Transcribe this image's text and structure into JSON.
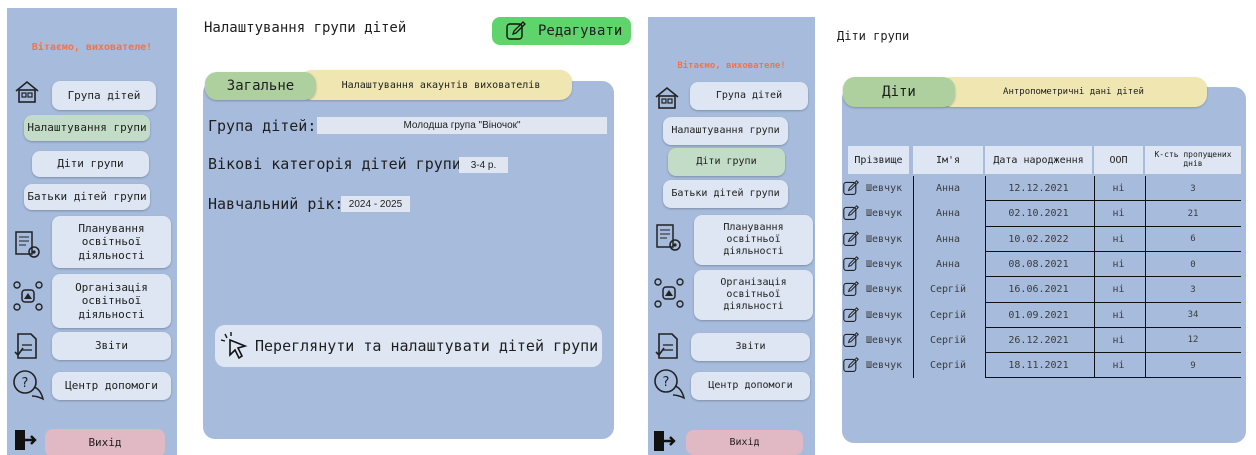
{
  "left_screen": {
    "welcome": "Вітаємо, вихователе!",
    "menu": {
      "group": "Група дітей",
      "group_settings": "Налаштування групи",
      "group_children": "Діти групи",
      "group_parents": "Батьки дітей групи",
      "planning": "Планування освітньої діяльності",
      "organization": "Організація освітньої діяльності",
      "reports": "Звіти",
      "help": "Центр допомоги",
      "exit": "Вихід"
    },
    "page_title": "Налаштування групи дітей",
    "edit_button": "Редагувати",
    "tabs": {
      "general": "Загальне",
      "accounts": "Налаштування акаунтів вихователів"
    },
    "fields": {
      "group_label": "Група дітей:",
      "group_value": "Молодша група \"Віночок\"",
      "age_label": "Вікові категорія дітей групи:",
      "age_value": "3-4 р.",
      "year_label": "Навчальний рік:",
      "year_value": "2024 - 2025"
    },
    "view_button": "Переглянути та налаштувати дітей групи"
  },
  "right_screen": {
    "welcome": "Вітаємо, вихователе!",
    "menu": {
      "group": "Група дітей",
      "group_settings": "Налаштування групи",
      "group_children": "Діти групи",
      "group_parents": "Батьки дітей групи",
      "planning": "Планування освітньої діяльності",
      "organization": "Організація освітньої діяльності",
      "reports": "Звіти",
      "help": "Центр допомоги",
      "exit": "Вихід"
    },
    "page_title": "Діти групи",
    "tabs": {
      "children": "Діти",
      "anthropometry": "Антропометричні дані дітей"
    },
    "table": {
      "headers": [
        "Прізвище",
        "Ім'я",
        "Дата народження",
        "ООП",
        "К-сть пропущених днів"
      ],
      "rows": [
        [
          "Шевчук",
          "Анна",
          "12.12.2021",
          "ні",
          "3"
        ],
        [
          "Шевчук",
          "Анна",
          "02.10.2021",
          "ні",
          "21"
        ],
        [
          "Шевчук",
          "Анна",
          "10.02.2022",
          "ні",
          "6"
        ],
        [
          "Шевчук",
          "Анна",
          "08.08.2021",
          "ні",
          "0"
        ],
        [
          "Шевчук",
          "Сергій",
          "16.06.2021",
          "ні",
          "3"
        ],
        [
          "Шевчук",
          "Сергій",
          "01.09.2021",
          "ні",
          "34"
        ],
        [
          "Шевчук",
          "Сергій",
          "26.12.2021",
          "ні",
          "12"
        ],
        [
          "Шевчук",
          "Сергій",
          "18.11.2021",
          "ні",
          "9"
        ]
      ]
    }
  }
}
